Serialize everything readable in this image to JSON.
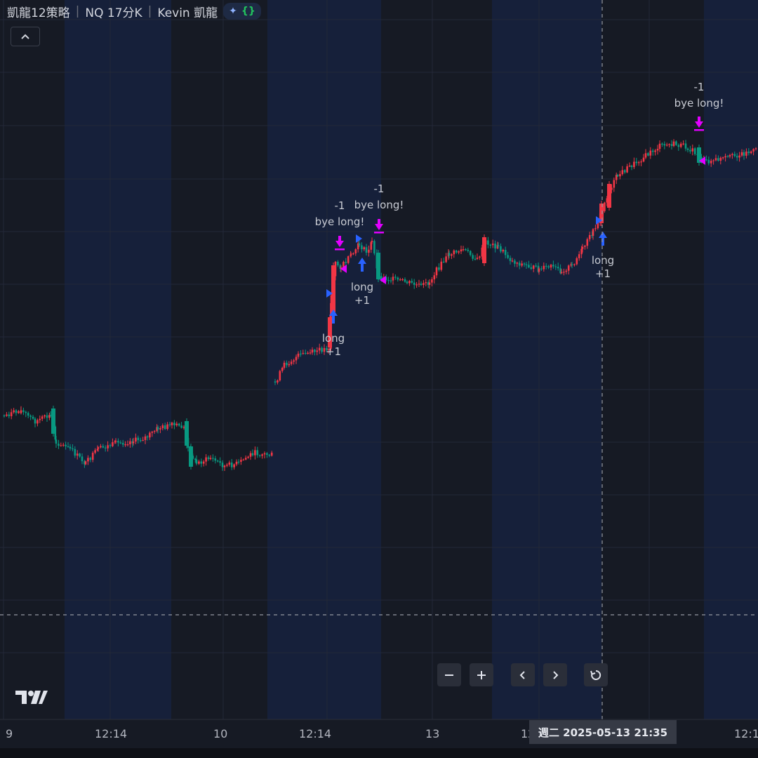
{
  "title": {
    "strategy": "凱龍12策略",
    "symbol_interval": "NQ 17分K",
    "author": "Kevin 凱龍"
  },
  "icons": {
    "collapse": "chevron-up-icon",
    "zoom_out": "minus-icon",
    "zoom_in": "plus-icon",
    "scroll_left": "chevron-left-icon",
    "scroll_right": "chevron-right-icon",
    "reset": "reset-icon",
    "logo": "tradingview-logo"
  },
  "x_axis_labels": [
    "9",
    "12:14",
    "10",
    "12:14",
    "13",
    "12",
    "12:1"
  ],
  "crosshair": {
    "time_label": "週二 2025-05-13   21:35"
  },
  "signals": {
    "entry_label": "long",
    "entry_qty": "+1",
    "exit_label": "bye long!",
    "exit_qty": "-1"
  },
  "colors": {
    "background": "#161a24",
    "session_band": "#16203a",
    "up_candle": "#f23645",
    "down_candle": "#089981",
    "entry_arrow": "#2962ff",
    "exit_arrow": "#e100ff",
    "text": "#d1d4dc"
  }
}
